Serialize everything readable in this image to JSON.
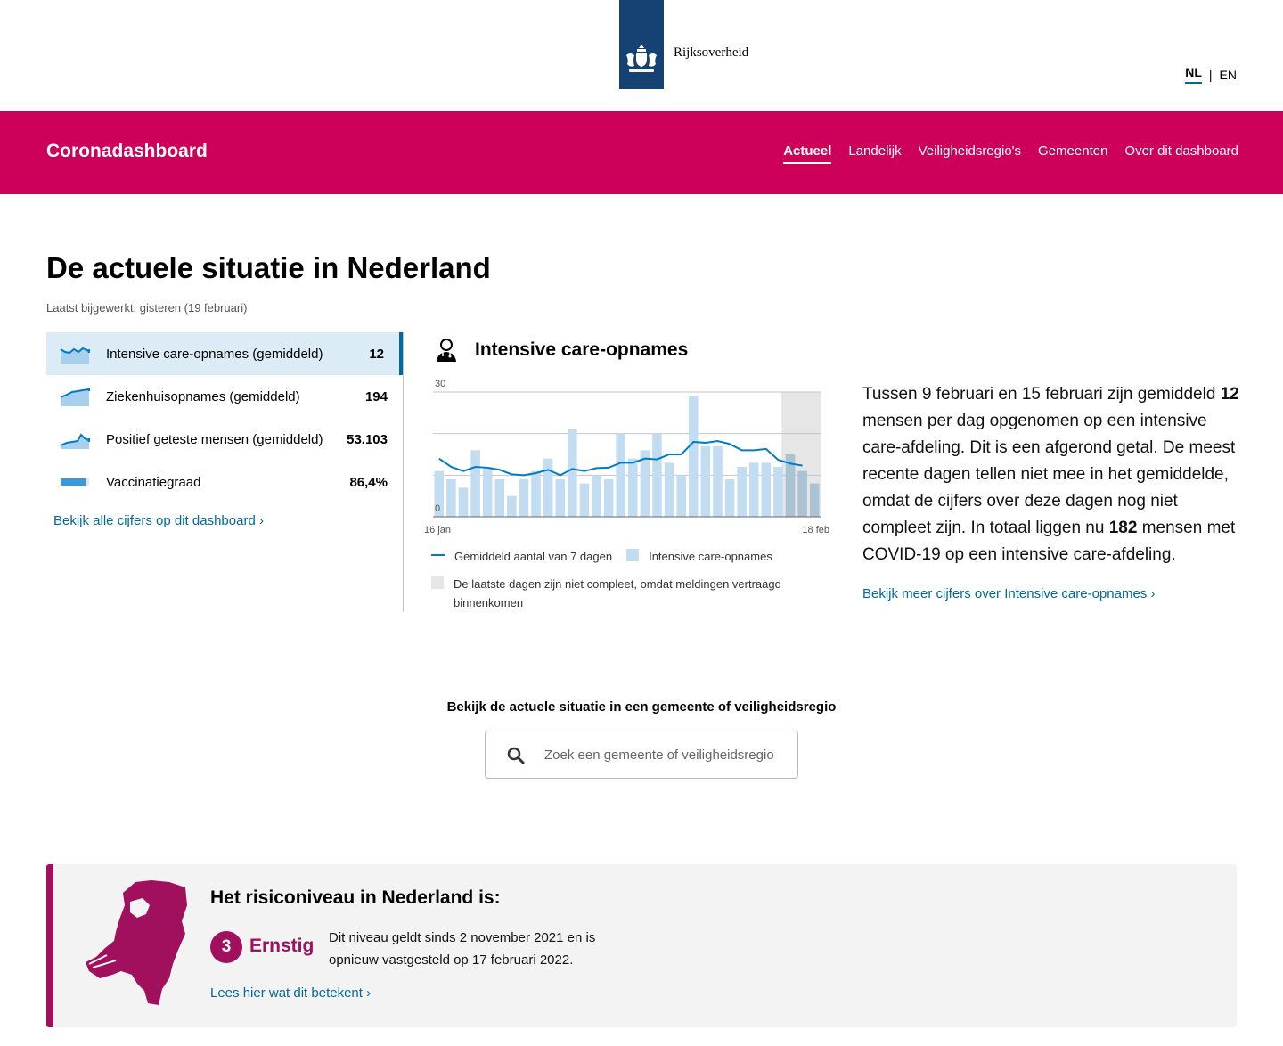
{
  "header": {
    "org_name": "Rijksoverheid",
    "languages": [
      "NL",
      "EN"
    ],
    "active_language": "NL"
  },
  "nav": {
    "brand": "Coronadashboard",
    "items": [
      "Actueel",
      "Landelijk",
      "Veiligheidsregio's",
      "Gemeenten",
      "Over dit dashboard"
    ],
    "active": "Actueel"
  },
  "main": {
    "title": "De actuele situatie in Nederland",
    "updated": "Laatst bijgewerkt: gisteren (19 februari)",
    "metrics": [
      {
        "label": "Intensive care-opnames (gemiddeld)",
        "value": "12",
        "icon": "ic-trend-icon"
      },
      {
        "label": "Ziekenhuisopnames (gemiddeld)",
        "value": "194",
        "icon": "hospital-trend-icon"
      },
      {
        "label": "Positief geteste mensen (gemiddeld)",
        "value": "53.103",
        "icon": "positive-trend-icon"
      },
      {
        "label": "Vaccinatiegraad",
        "value": "86,4%",
        "icon": "vaccination-bar-icon"
      }
    ],
    "all_link": "Bekijk alle cijfers op dit dashboard ›"
  },
  "chart_section": {
    "title": "Intensive care-opnames",
    "legend_line": "Gemiddeld aantal van 7 dagen",
    "legend_bar": "Intensive care-opnames",
    "legend_incomplete": "De laatste dagen zijn niet compleet, omdat meldingen vertraagd binnenkomen"
  },
  "chart_data": {
    "type": "bar",
    "x_start_label": "16 jan",
    "x_end_label": "18 feb",
    "ylim": [
      0,
      30
    ],
    "y_ticks": [
      "0",
      "30"
    ],
    "bars": [
      11,
      9,
      7,
      16,
      12,
      9,
      5,
      9,
      11,
      14,
      9,
      21,
      8,
      10,
      9,
      20,
      14,
      16,
      20,
      13,
      10,
      29,
      17,
      17,
      9,
      12,
      13,
      13,
      12,
      15,
      11,
      8
    ],
    "avg": [
      14,
      12,
      11,
      12,
      11.8,
      11.3,
      10.2,
      10,
      10.5,
      11.3,
      10,
      11.5,
      11,
      11.7,
      11.8,
      13,
      13,
      14,
      13.8,
      15,
      15,
      18,
      17.8,
      18.2,
      17.5,
      16,
      16,
      16.3,
      13.7,
      12.8,
      12.3
    ],
    "incomplete_from_index": 29,
    "bar_color": "#c2ddf1",
    "line_color": "#007bc7"
  },
  "description": {
    "part1": "Tussen 9 februari en 15 februari zijn gemiddeld ",
    "avg_value": "12",
    "part2": " mensen per dag opgenomen op een intensive care-afdeling. Dit is een afgerond getal. De meest recente dagen tellen niet mee in het gemiddelde, omdat de cijfers over deze dagen nog niet compleet zijn. In totaal liggen nu ",
    "total_value": "182",
    "part3": " mensen met COVID-19 op een intensive care-afdeling.",
    "more_link": "Bekijk meer cijfers over Intensive care-opnames ›"
  },
  "search": {
    "label": "Bekijk de actuele situatie in een gemeente of veiligheidsregio",
    "placeholder": "Zoek een gemeente of veiligheidsregio"
  },
  "risk": {
    "title": "Het risiconiveau in Nederland is:",
    "level_number": "3",
    "level_name": "Ernstig",
    "text": "Dit niveau geldt sinds 2 november 2021 en is opnieuw vastgesteld op 17 februari 2022.",
    "link": "Lees hier wat dit betekent ›"
  },
  "colors": {
    "brand": "#cd005a",
    "link": "#01689b",
    "risk": "#a0105c",
    "rijks_blue": "#154273"
  }
}
